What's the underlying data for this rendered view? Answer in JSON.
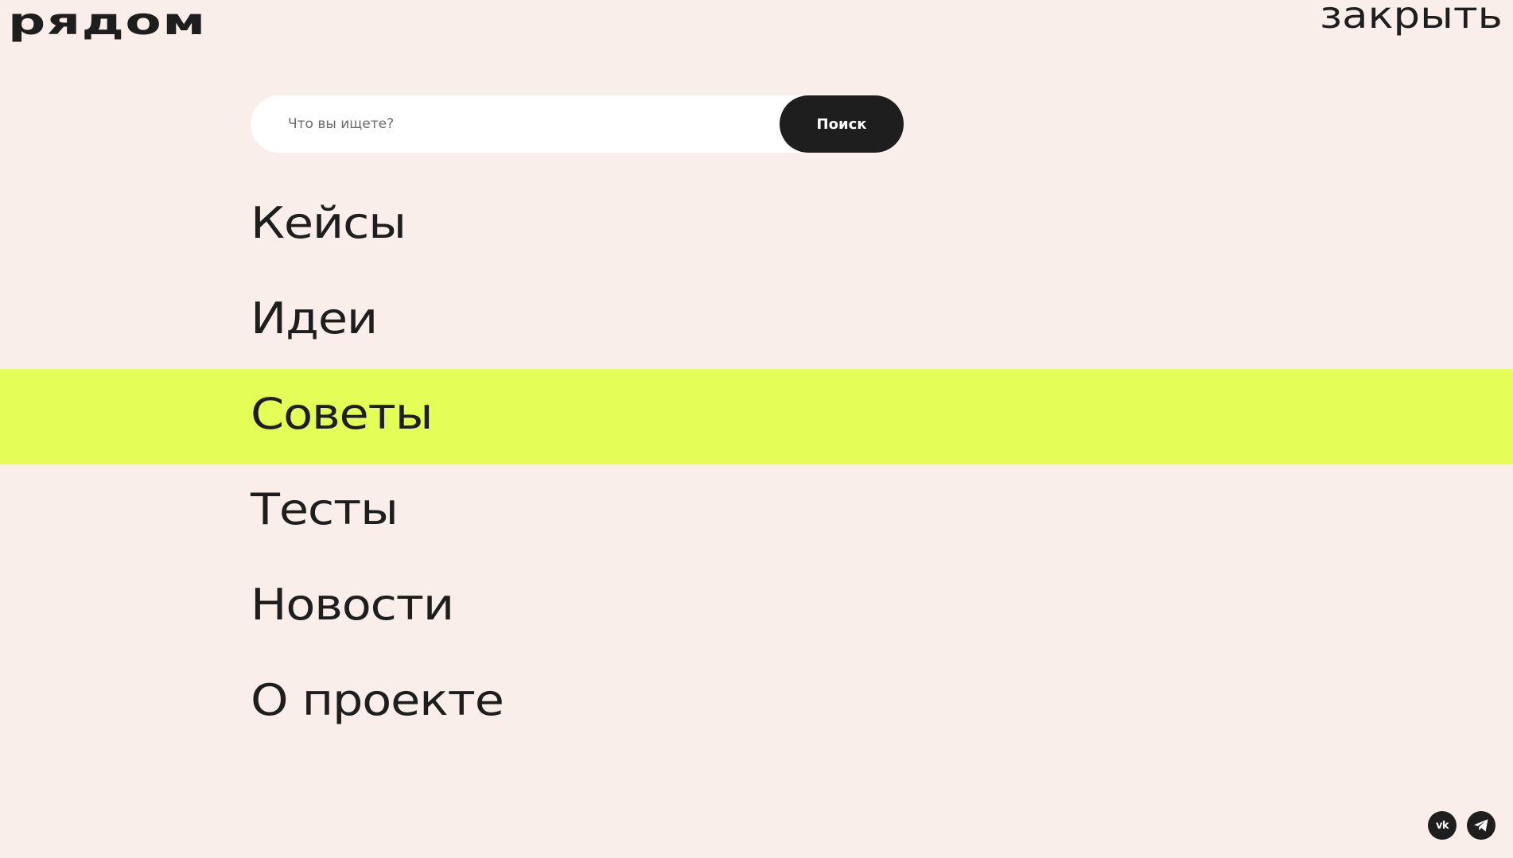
{
  "header": {
    "logo_text": "рядом",
    "close_label": "закрыть"
  },
  "search": {
    "placeholder": "Что вы ищете?",
    "button_label": "Поиск"
  },
  "nav": {
    "items": [
      {
        "label": "Кейсы",
        "active": false
      },
      {
        "label": "Идеи",
        "active": false
      },
      {
        "label": "Советы",
        "active": true
      },
      {
        "label": "Тесты",
        "active": false
      },
      {
        "label": "Новости",
        "active": false
      },
      {
        "label": "О проекте",
        "active": false
      }
    ]
  },
  "social": {
    "items": [
      {
        "icon": "vk-icon",
        "glyph": "vk"
      },
      {
        "icon": "telegram-icon"
      }
    ]
  },
  "colors": {
    "background": "#f9eee9",
    "highlight": "#e5fe57",
    "text": "#1e1e1e",
    "button": "#1e1e1e"
  }
}
